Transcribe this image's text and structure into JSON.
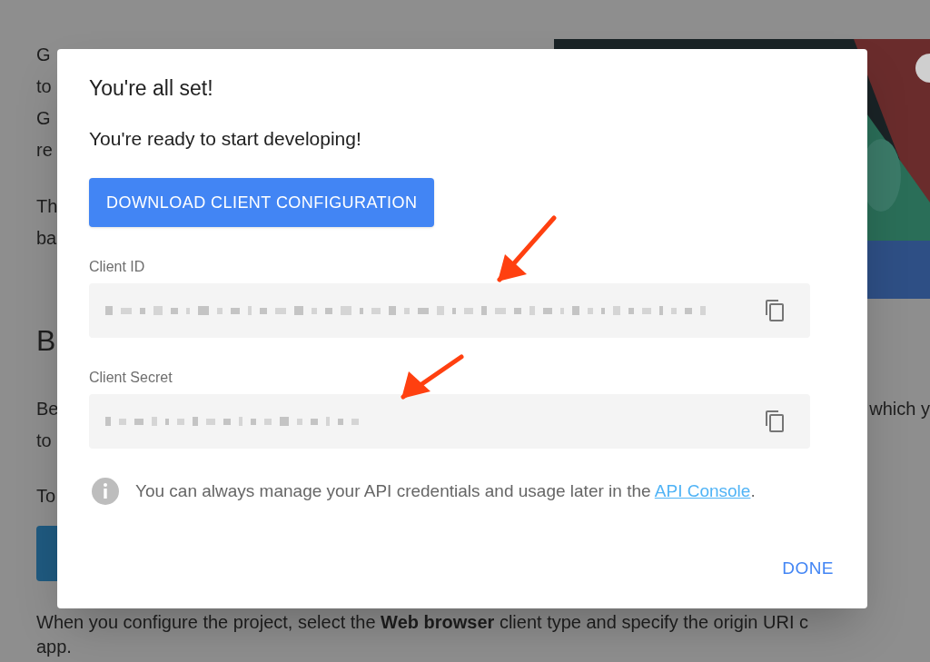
{
  "page": {
    "intro_lines": [
      "G",
      "to",
      "G"
    ],
    "intro_link": "re",
    "second_lines": [
      "Th",
      "ba"
    ],
    "heading": "B",
    "third_lines": [
      "Be",
      "to"
    ],
    "right_fragment": "which y",
    "fourth_line": "To",
    "bottom_lines": [
      "When you configure the project, select the **Web browser** client type and specify the origin URI c",
      "app."
    ]
  },
  "dialog": {
    "title": "You're all set!",
    "subtitle": "You're ready to start developing!",
    "download_button": "DOWNLOAD CLIENT CONFIGURATION",
    "fields": [
      {
        "label": "Client ID"
      },
      {
        "label": "Client Secret"
      }
    ],
    "info_text": "You can always manage your API credentials and usage later in the",
    "info_link": "API Console",
    "info_end": ".",
    "done_button": "DONE"
  }
}
